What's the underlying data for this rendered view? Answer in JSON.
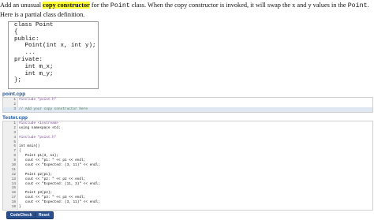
{
  "prompt": {
    "lead": "Add an unusual ",
    "highlight": "copy constructor",
    "mid1": " for the ",
    "point1": "Point",
    "mid2": " class. When the copy constructor is invoked, it will swap the x and y values in the ",
    "point2": "Point",
    "tail": ". Here is a partial class definition."
  },
  "class_definition": [
    "class Point",
    "{",
    "public:",
    "   Point(int x, int y);",
    "   ...",
    "private:",
    "   int m_x;",
    "   int m_y;",
    "};"
  ],
  "files": [
    {
      "name": "point.cpp",
      "lines": [
        {
          "n": "1",
          "text": "#include \"point.h\""
        },
        {
          "n": "2",
          "text": ""
        },
        {
          "n": "3",
          "text": "// Add your copy constructor here"
        }
      ]
    },
    {
      "name": "Tester.cpp",
      "lines": [
        {
          "n": "1",
          "text": "#include <iostream>"
        },
        {
          "n": "2",
          "text": "using namespace std;"
        },
        {
          "n": "3",
          "text": ""
        },
        {
          "n": "4",
          "text": "#include \"point.h\""
        },
        {
          "n": "5",
          "text": ""
        },
        {
          "n": "6",
          "text": "int main()"
        },
        {
          "n": "7",
          "text": "{"
        },
        {
          "n": "8",
          "text": "   Point p1(3, 11);"
        },
        {
          "n": "9",
          "text": "   cout << \"p1: \" << p1 << endl;"
        },
        {
          "n": "10",
          "text": "   cout << \"Expected: (3, 11)\" << endl;"
        },
        {
          "n": "11",
          "text": ""
        },
        {
          "n": "12",
          "text": "   Point p2(p1);"
        },
        {
          "n": "13",
          "text": "   cout << \"p2: \" << p2 << endl;"
        },
        {
          "n": "14",
          "text": "   cout << \"Expected: (11, 3)\" << endl;"
        },
        {
          "n": "15",
          "text": ""
        },
        {
          "n": "16",
          "text": "   Point p3(p2);"
        },
        {
          "n": "17",
          "text": "   cout << \"p3: \" << p3 << endl;"
        },
        {
          "n": "18",
          "text": "   cout << \"Expected: (3, 11)\" << endl;"
        },
        {
          "n": "19",
          "text": "}"
        }
      ]
    }
  ],
  "buttons": {
    "codecheck": "CodeCheck",
    "reset": "Reset"
  },
  "colors": {
    "highlight": "#ffff33",
    "file_label": "#1a55a0",
    "button": "#2a4f8e"
  }
}
